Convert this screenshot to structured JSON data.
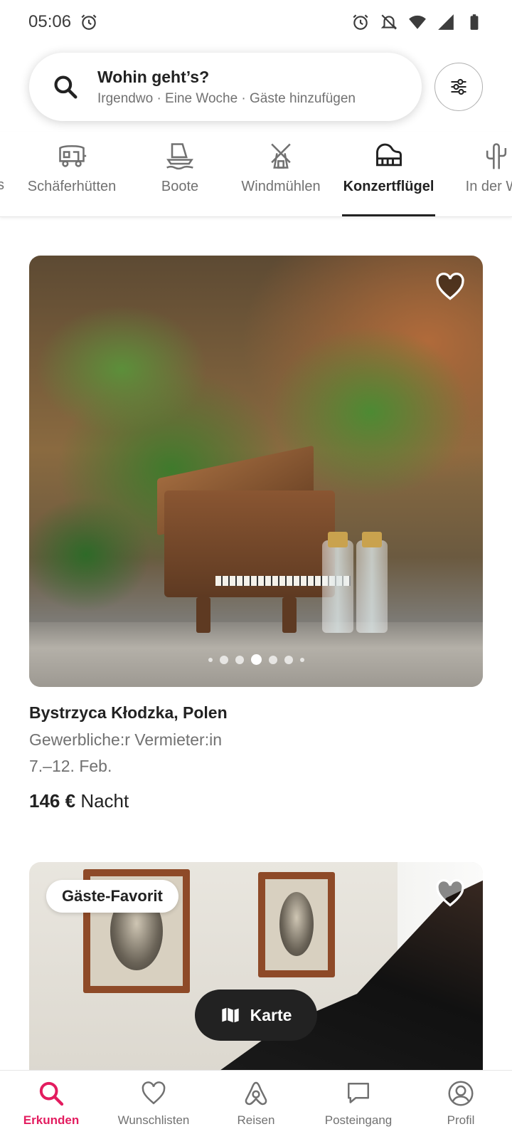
{
  "status_bar": {
    "time": "05:06"
  },
  "search": {
    "title": "Wohin geht’s?",
    "subtitle": "Irgendwo · Eine Woche · Gäste hinzufügen"
  },
  "categories": {
    "items": [
      {
        "label": "s",
        "icon": "category-icon"
      },
      {
        "label": "Schäferhütten",
        "icon": "shepherd-hut-icon"
      },
      {
        "label": "Boote",
        "icon": "boat-icon"
      },
      {
        "label": "Windmühlen",
        "icon": "windmill-icon"
      },
      {
        "label": "Konzertflügel",
        "icon": "grand-piano-icon",
        "active": true
      },
      {
        "label": "In der Wü",
        "icon": "cactus-icon"
      }
    ]
  },
  "listing": {
    "location": "Bystrzyca Kłodzka, Polen",
    "host_type": "Gewerbliche:r Vermieter:in",
    "dates": "7.–12. Feb.",
    "price": "146 €",
    "price_unit": "Nacht",
    "image_count": 7,
    "current_image_index": 4
  },
  "listing2": {
    "badge": "Gäste-Favorit"
  },
  "map_button": {
    "label": "Karte"
  },
  "bottom_nav": {
    "items": [
      {
        "label": "Erkunden",
        "active": true
      },
      {
        "label": "Wunschlisten"
      },
      {
        "label": "Reisen"
      },
      {
        "label": "Posteingang"
      },
      {
        "label": "Profil"
      }
    ]
  },
  "colors": {
    "accent": "#e31c5f",
    "text_primary": "#222222",
    "text_secondary": "#717171"
  }
}
